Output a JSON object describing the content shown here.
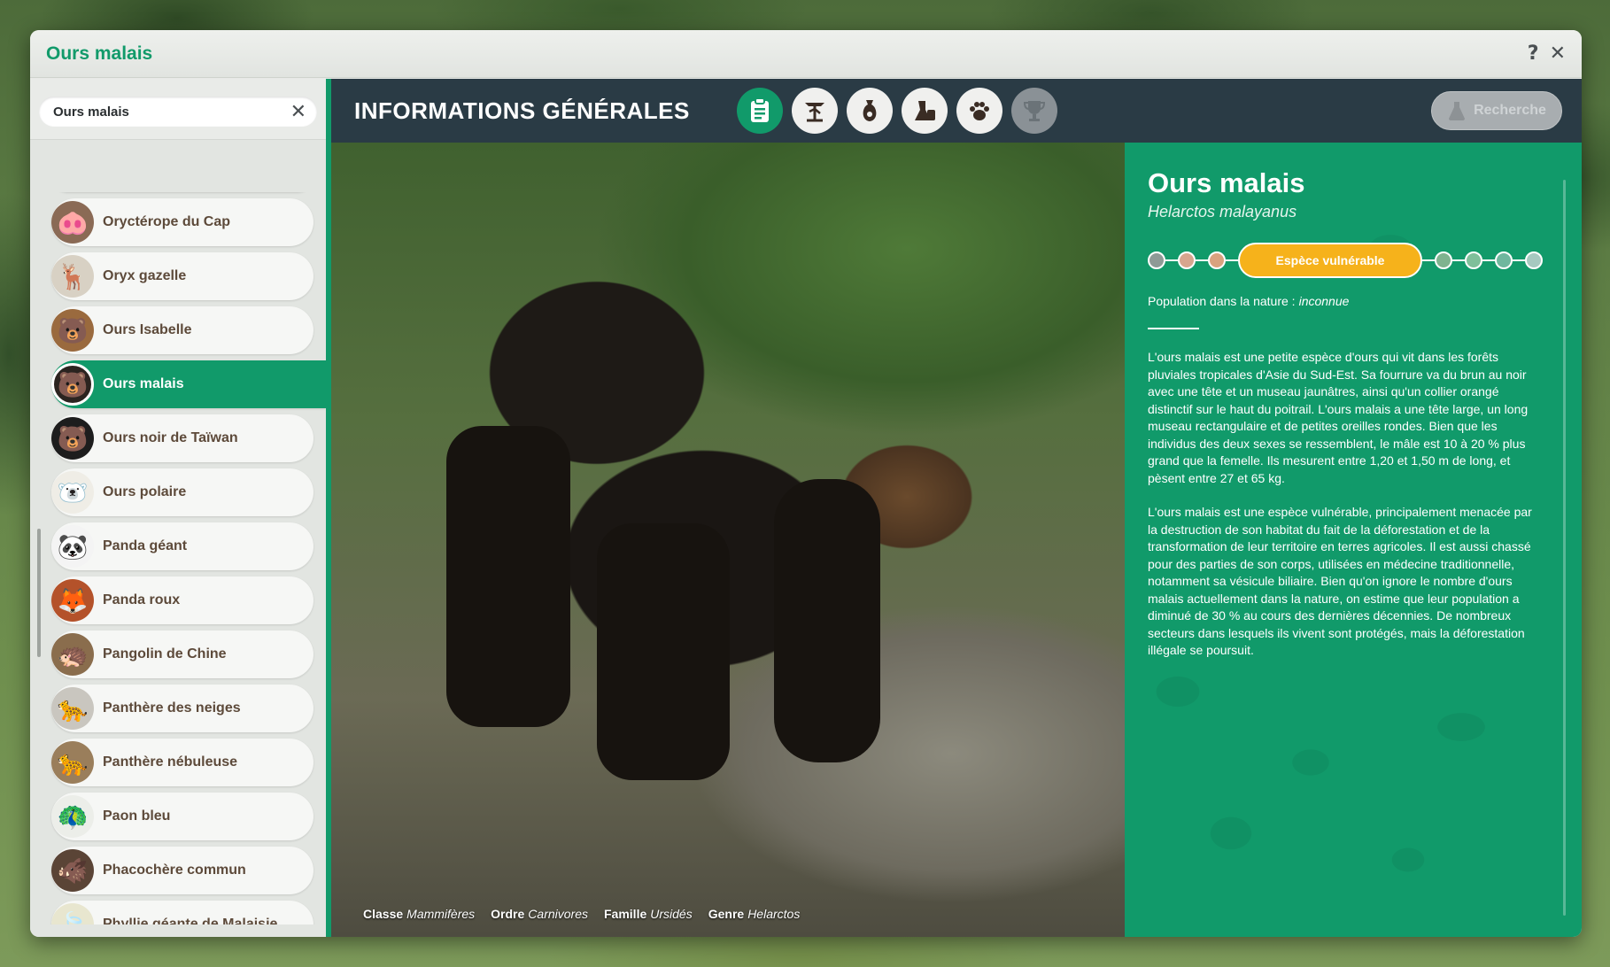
{
  "window": {
    "title": "Ours malais",
    "help_label": "?",
    "close_label": "✕"
  },
  "search": {
    "value": "Ours malais",
    "clear_label": "✕"
  },
  "animals": [
    {
      "label": "Oryctérope du Cap",
      "icon": "aardvark-icon",
      "glyph": "🐽",
      "color": "#8a6a55"
    },
    {
      "label": "Oryx gazelle",
      "icon": "oryx-icon",
      "glyph": "🦌",
      "color": "#d8d1c4"
    },
    {
      "label": "Ours Isabelle",
      "icon": "brown-bear-icon",
      "glyph": "🐻",
      "color": "#9a6a3e"
    },
    {
      "label": "Ours malais",
      "icon": "sun-bear-icon",
      "glyph": "🐻",
      "color": "#2b2420",
      "active": true
    },
    {
      "label": "Ours noir de Taïwan",
      "icon": "black-bear-icon",
      "glyph": "🐻",
      "color": "#1d1d1d"
    },
    {
      "label": "Ours polaire",
      "icon": "polar-bear-icon",
      "glyph": "🐻‍❄️",
      "color": "#efede6"
    },
    {
      "label": "Panda géant",
      "icon": "giant-panda-icon",
      "glyph": "🐼",
      "color": "#f4f4f4"
    },
    {
      "label": "Panda roux",
      "icon": "red-panda-icon",
      "glyph": "🦊",
      "color": "#b4522a"
    },
    {
      "label": "Pangolin de Chine",
      "icon": "pangolin-icon",
      "glyph": "🦔",
      "color": "#8a6d4d"
    },
    {
      "label": "Panthère des neiges",
      "icon": "snow-leopard-icon",
      "glyph": "🐆",
      "color": "#c9c6bf"
    },
    {
      "label": "Panthère nébuleuse",
      "icon": "clouded-leopard-icon",
      "glyph": "🐆",
      "color": "#9a7e5b"
    },
    {
      "label": "Paon bleu",
      "icon": "peacock-icon",
      "glyph": "🦚",
      "color": "#eceee9"
    },
    {
      "label": "Phacochère commun",
      "icon": "warthog-icon",
      "glyph": "🐗",
      "color": "#5a4436"
    },
    {
      "label": "Phyllie géante de Malaisie",
      "icon": "leaf-insect-icon",
      "glyph": "🍃",
      "color": "#e8e6cf"
    }
  ],
  "header": {
    "title": "INFORMATIONS GÉNÉRALES",
    "research_label": "Recherche"
  },
  "tabs": [
    {
      "icon": "clipboard-icon",
      "state": "active"
    },
    {
      "icon": "habitat-icon",
      "state": "normal"
    },
    {
      "icon": "food-sack-icon",
      "state": "normal"
    },
    {
      "icon": "enrichment-icon",
      "state": "normal"
    },
    {
      "icon": "paw-icon",
      "state": "normal"
    },
    {
      "icon": "trophy-icon",
      "state": "disabled"
    }
  ],
  "taxonomy": {
    "class_label": "Classe",
    "class_value": "Mammifères",
    "order_label": "Ordre",
    "order_value": "Carnivores",
    "family_label": "Famille",
    "family_value": "Ursidés",
    "genus_label": "Genre",
    "genus_value": "Helarctos"
  },
  "species": {
    "name": "Ours malais",
    "latin": "Helarctos malayanus",
    "status_label": "Espèce vulnérable",
    "status_dots_left": [
      "#8e9a96",
      "#d7a58e",
      "#d9a27f"
    ],
    "status_dots_right": [
      "#7fb38f",
      "#7fbf9a",
      "#6fb79e",
      "#a6c9c0"
    ],
    "population_label": "Population dans la nature :",
    "population_value": "inconnue",
    "description_1": "L'ours malais est une petite espèce d'ours qui vit dans les forêts pluviales tropicales d'Asie du Sud-Est. Sa fourrure va du brun au noir avec une tête et un museau jaunâtres, ainsi qu'un collier orangé distinctif sur le haut du poitrail. L'ours malais a une tête large, un long museau rectangulaire et de petites oreilles rondes. Bien que les individus des deux sexes se ressemblent, le mâle est 10 à 20 % plus grand que la femelle. Ils mesurent entre 1,20 et 1,50 m de long, et pèsent entre 27 et 65 kg.",
    "description_2": "L'ours malais est une espèce vulnérable, principalement menacée par la destruction de son habitat du fait de la déforestation et de la transformation de leur territoire en terres agricoles. Il est aussi chassé pour des parties de son corps, utilisées en médecine traditionnelle, notamment sa vésicule biliaire. Bien qu'on ignore le nombre d'ours malais actuellement dans la nature, on estime que leur population a diminué de 30 % au cours des dernières décennies. De nombreux secteurs dans lesquels ils vivent sont protégés, mais la déforestation illégale se poursuit."
  },
  "colors": {
    "accent": "#119a6a",
    "header_bg": "#2a3b45",
    "status": "#f6b21b"
  }
}
